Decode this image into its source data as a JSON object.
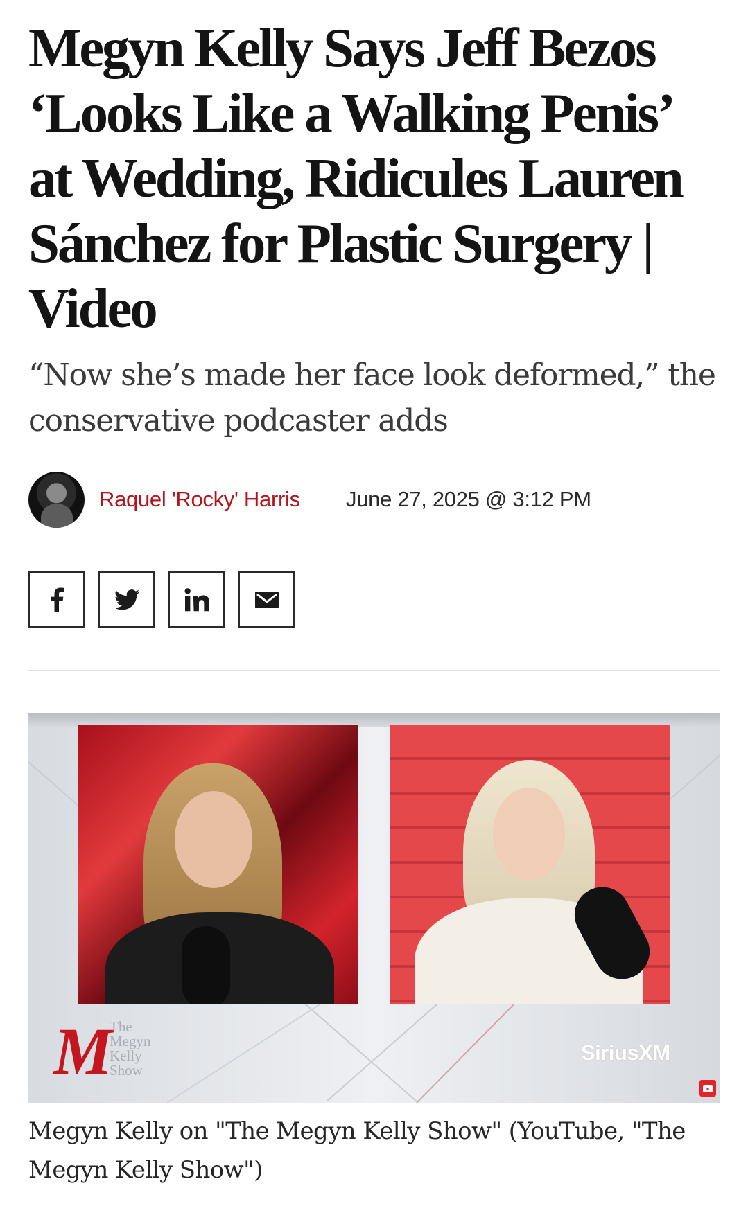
{
  "article": {
    "headline": "Megyn Kelly Says Jeff Bezos ‘Looks Like a Walking Penis’ at Wedding, Ridicules Lauren Sánchez for Plastic Surgery | Video",
    "dek": "“Now she’s made her face look deformed,” the conservative podcaster adds",
    "author": "Raquel 'Rocky' Harris",
    "date": "June 27, 2025 @ 3:12 PM"
  },
  "share": {
    "buttons": [
      {
        "icon": "facebook-icon"
      },
      {
        "icon": "twitter-icon"
      },
      {
        "icon": "linkedin-icon"
      },
      {
        "icon": "email-icon"
      }
    ]
  },
  "media": {
    "brand_lines": [
      "The",
      "Megyn",
      "Kelly",
      "Show"
    ],
    "watermark": "SiriusXM",
    "caption": "Megyn Kelly on \"The Megyn Kelly Show\" (YouTube, \"The Megyn Kelly Show\")"
  },
  "colors": {
    "accent": "#b3151c",
    "brand_red": "#c4161f"
  }
}
